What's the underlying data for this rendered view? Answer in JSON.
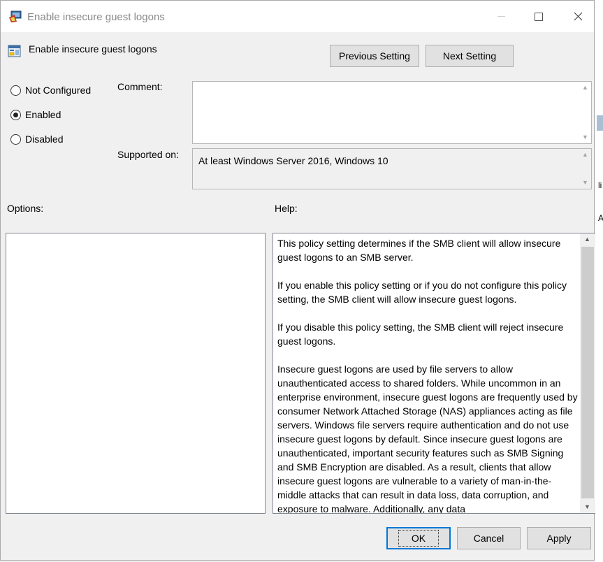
{
  "window": {
    "title": "Enable insecure guest logons",
    "controls": {
      "minimize": "",
      "maximize": "",
      "close": "✕"
    }
  },
  "policy": {
    "name": "Enable insecure guest logons"
  },
  "nav": {
    "previous": "Previous Setting",
    "next": "Next Setting"
  },
  "state": {
    "options": [
      {
        "label": "Not Configured",
        "checked": false
      },
      {
        "label": "Enabled",
        "checked": true
      },
      {
        "label": "Disabled",
        "checked": false
      }
    ]
  },
  "comment": {
    "label": "Comment:",
    "value": ""
  },
  "supported": {
    "label": "Supported on:",
    "value": "At least Windows Server 2016, Windows 10"
  },
  "options_label": "Options:",
  "help_label": "Help:",
  "help": {
    "paragraphs": [
      "This policy setting determines if the SMB client will allow insecure guest logons to an SMB server.",
      "If you enable this policy setting or if you do not configure this policy setting, the SMB client will allow insecure guest logons.",
      "If you disable this policy setting, the SMB client will reject insecure guest logons.",
      "Insecure guest logons are used by file servers to allow unauthenticated access to shared folders. While uncommon in an enterprise environment, insecure guest logons are frequently used by consumer Network Attached Storage (NAS) appliances acting as file servers. Windows file servers require authentication and do not use insecure guest logons by default. Since insecure guest logons are unauthenticated, important security features such as SMB Signing and SMB Encryption are disabled. As a result, clients that allow insecure guest logons are vulnerable to a variety of man-in-the-middle attacks that can result in data loss, data corruption, and exposure to malware. Additionally, any data"
    ]
  },
  "buttons": {
    "ok": "OK",
    "cancel": "Cancel",
    "apply": "Apply"
  },
  "background_edge": {
    "text_1": "li",
    "text_2": "A"
  },
  "colors": {
    "accent": "#0078d7",
    "window_bg": "#f0f0f0",
    "titlebar_bg": "#ffffff"
  }
}
